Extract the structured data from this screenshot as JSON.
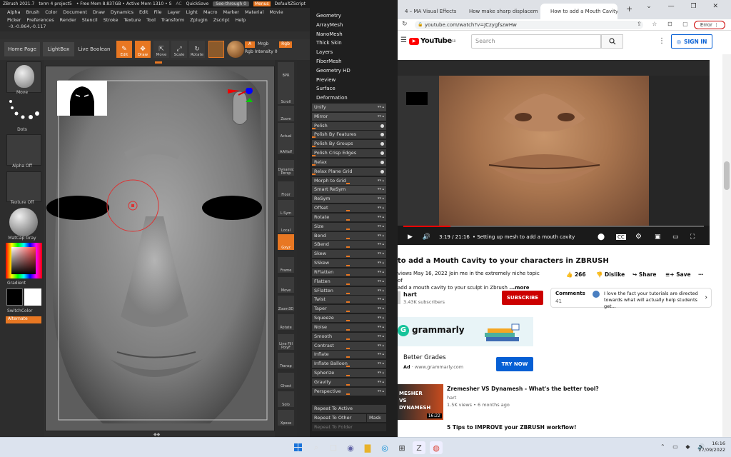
{
  "zbrush": {
    "title": "ZBrush 2021.7",
    "doc": "term 4 project5",
    "free_mem": "• Free Mem 8.837GB • Active Mem 1310 • S",
    "ac": "AC",
    "quicksave": "QuickSave",
    "see_through": "See-through  0",
    "menus": "Menus",
    "default_script": "DefaultZScript",
    "menu_row1": [
      "Alpha",
      "Brush",
      "Color",
      "Document",
      "Draw",
      "Dynamics",
      "Edit",
      "File",
      "Layer",
      "Light",
      "Macro",
      "Marker",
      "Material",
      "Movie"
    ],
    "menu_row2": [
      "Picker",
      "Preferences",
      "Render",
      "Stencil",
      "Stroke",
      "Texture",
      "Tool",
      "Transform",
      "Zplugin",
      "Zscript",
      "Help"
    ],
    "coords": "-0.-0.864,-0.117",
    "toolbar": {
      "home": "Home Page",
      "lightbox": "LightBox",
      "live_boolean": "Live Boolean",
      "edit": "Edit",
      "draw": "Draw",
      "move": "Move",
      "scale": "Scale",
      "rotate": "Rotate",
      "a_label": "A",
      "mrgb": "Mrgb",
      "rgb": "Rgb",
      "rgb_intensity": "Rgb Intensity 0"
    },
    "left_shelf": {
      "move": "Move",
      "dots": "Dots",
      "alpha_off": "Alpha Off",
      "texture_off": "Texture Off",
      "matcap": "MatCap Gray",
      "gradient": "Gradient",
      "switch_color": "SwitchColor",
      "alternate": "Alternate"
    },
    "right_shelf": [
      "BPR",
      "SPix 3",
      "Scroll",
      "Zoom",
      "Actual",
      "AAHalf",
      "Dynamic Persp",
      "Floor",
      "L.Sym",
      "Local",
      "Gxyz",
      "Frame",
      "Move",
      "Zoom3D",
      "Rotate",
      "Line Fill PolyF",
      "Transp",
      "Ghost",
      "Solo",
      "Xpose"
    ],
    "top_list": [
      "Geometry",
      "ArrayMesh",
      "NanoMesh",
      "Thick Skin",
      "Layers",
      "FiberMesh",
      "Geometry HD",
      "Preview",
      "Surface",
      "Deformation"
    ],
    "deform_items": [
      {
        "label": "Unify",
        "kind": "btn"
      },
      {
        "label": "Mirror",
        "kind": "btn"
      },
      {
        "label": "Polish",
        "kind": "dot"
      },
      {
        "label": "Polish By Features",
        "kind": "dot"
      },
      {
        "label": "Polish By Groups",
        "kind": "dot"
      },
      {
        "label": "Polish Crisp Edges",
        "kind": "dot"
      },
      {
        "label": "Relax",
        "kind": "dot"
      },
      {
        "label": "Relax Plane Grid",
        "kind": "dot"
      },
      {
        "label": "Morph to Grid",
        "kind": "slider"
      },
      {
        "label": "Smart ReSym",
        "kind": "btn"
      },
      {
        "label": "ReSym",
        "kind": "btn"
      },
      {
        "label": "Offset",
        "kind": "slider"
      },
      {
        "label": "Rotate",
        "kind": "slider"
      },
      {
        "label": "Size",
        "kind": "slider"
      },
      {
        "label": "Bend",
        "kind": "slider"
      },
      {
        "label": "SBend",
        "kind": "slider"
      },
      {
        "label": "Skew",
        "kind": "slider"
      },
      {
        "label": "SSkew",
        "kind": "slider"
      },
      {
        "label": "RFlatten",
        "kind": "slider"
      },
      {
        "label": "Flatten",
        "kind": "slider"
      },
      {
        "label": "SFlatten",
        "kind": "slider"
      },
      {
        "label": "Twist",
        "kind": "slider"
      },
      {
        "label": "Taper",
        "kind": "slider"
      },
      {
        "label": "Squeeze",
        "kind": "slider"
      },
      {
        "label": "Noise",
        "kind": "slider"
      },
      {
        "label": "Smooth",
        "kind": "slider"
      },
      {
        "label": "Contrast",
        "kind": "slider"
      },
      {
        "label": "Inflate",
        "kind": "slider"
      },
      {
        "label": "Inflate Balloon",
        "kind": "slider"
      },
      {
        "label": "Spherize",
        "kind": "slider"
      },
      {
        "label": "Gravity",
        "kind": "slider"
      },
      {
        "label": "Perspective",
        "kind": "slider"
      }
    ],
    "repeat_active": "Repeat To Active",
    "repeat_other": "Repeat To Other",
    "mask": "Mask",
    "repeat_folder": "Repeat To Folder",
    "accent_color": "#e87722"
  },
  "chrome": {
    "tabs": [
      {
        "label": "4 – MA Visual Effects"
      },
      {
        "label": "How make sharp displaceme"
      },
      {
        "label": "How to add a Mouth Cavity"
      }
    ],
    "url": "youtube.com/watch?v=JCzygfszwHw",
    "error_label": "Error"
  },
  "youtube": {
    "logo": "YouTube",
    "region": "GB",
    "search_placeholder": "Search",
    "sign_in": "SIGN IN",
    "time": "3:19 / 21:16",
    "chapter": "• Setting up mesh to add a mouth cavity",
    "progress": 0.156,
    "title": "to add a Mouth Cavity to your characters in ZBRUSH",
    "meta": "views  May 16, 2022  Join me in the extremely niche topic of",
    "meta2": "add a mouth cavity to your sculpt in Zbrush",
    "more": "...more",
    "likes": "266",
    "dislike": "Dislike",
    "share": "Share",
    "save": "Save",
    "channel": "hart",
    "subscribers": "3.43K subscribers",
    "subscribe": "SUBSCRIBE",
    "comments_label": "Comments",
    "comments_count": "41",
    "comment_text": "I love the fact your tutorials are directed towards what will actually help students get...",
    "ad_brand": "grammarly",
    "ad_title": "Better Grades",
    "ad_label": "Ad",
    "ad_url": "www.grammarly.com",
    "try_now": "TRY NOW",
    "rec1_title": "Zremesher VS Dynamesh - What's the better tool?",
    "rec1_channel": "hart",
    "rec1_meta": "1.5K views • 6 months ago",
    "rec1_duration": "16:22",
    "rec1_thumb": "MESHER VS DYNAMESH",
    "rec2_title": "5 Tips to IMPROVE your ZBRUSH workflow!"
  },
  "taskbar": {
    "time": "16:16",
    "date": "27/09/2022"
  }
}
